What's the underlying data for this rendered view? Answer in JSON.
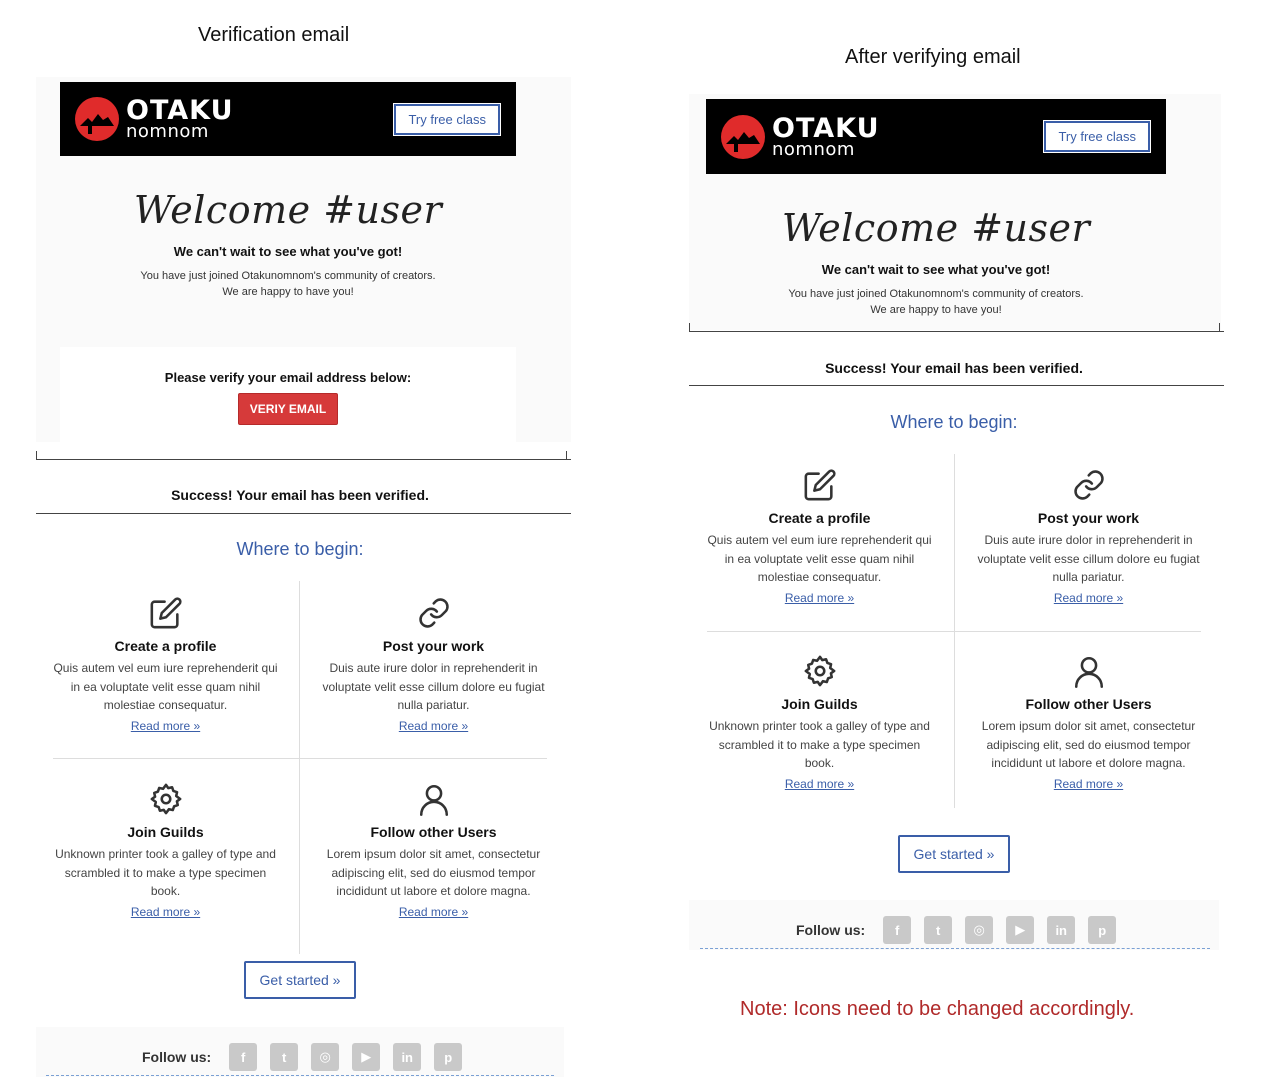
{
  "captions": {
    "left": "Verification email",
    "right": "After verifying email"
  },
  "brand": {
    "logo_main": "OTAKU",
    "logo_sub": "nomnom",
    "logo_color": "#e02b2b"
  },
  "header": {
    "trial_label": "Try free class"
  },
  "welcome": {
    "title": "Welcome #user",
    "subtitle": "We can't wait to see what you've got!",
    "line1": "You have just joined Otakunomnom's community of creators.",
    "line2": "We are happy to have you!"
  },
  "verify": {
    "label": "Please verify your email address below:",
    "button_label": "VERIY EMAIL"
  },
  "success": {
    "message": "Success! Your email has been verified."
  },
  "begin": {
    "title": "Where to begin:",
    "items": [
      {
        "icon": "edit-icon",
        "title": "Create a profile",
        "desc": "Quis autem vel eum iure reprehenderit qui in ea voluptate velit esse quam nihil molestiae consequatur.",
        "link": "Read more »"
      },
      {
        "icon": "link-icon",
        "title": "Post your work",
        "desc": "Duis aute irure dolor in reprehenderit in voluptate velit esse cillum dolore eu fugiat nulla pariatur.",
        "link": "Read more »"
      },
      {
        "icon": "gear-icon",
        "title": "Join Guilds",
        "desc": "Unknown printer took a galley of type and scrambled it to make a type specimen book.",
        "link": "Read more »"
      },
      {
        "icon": "user-icon",
        "title": "Follow other Users",
        "desc": "Lorem ipsum dolor sit amet, consectetur adipiscing elit, sed do eiusmod tempor incididunt ut labore et dolore magna.",
        "link": "Read more »"
      }
    ],
    "start_label": "Get started »"
  },
  "follow": {
    "label": "Follow us:",
    "networks": [
      "facebook-icon",
      "twitter-icon",
      "instagram-icon",
      "youtube-icon",
      "linkedin-icon",
      "pinterest-icon"
    ],
    "glyphs": [
      "f",
      "t",
      "◎",
      "▶",
      "in",
      "p"
    ]
  },
  "note": "Note: Icons need to be changed accordingly.",
  "colors": {
    "accent_blue": "#3a5ea8",
    "verify_red": "#d63a3a",
    "note_red": "#b02a2a"
  }
}
